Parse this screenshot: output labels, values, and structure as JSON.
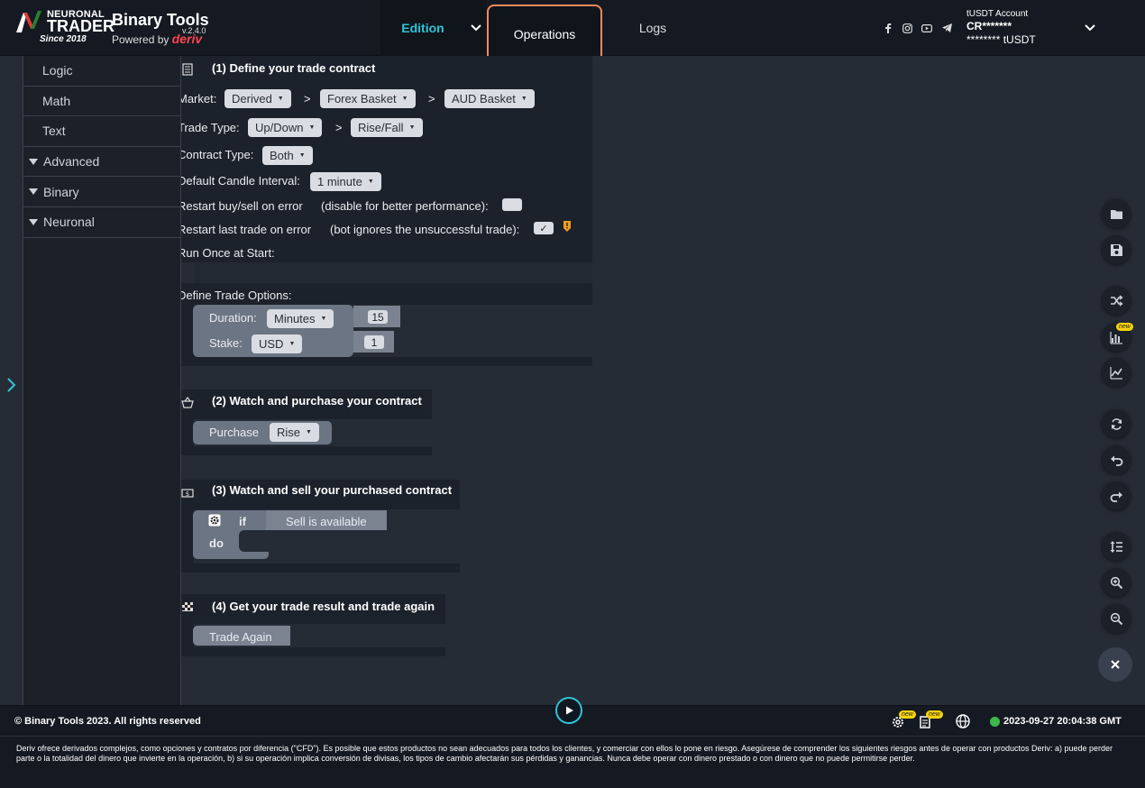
{
  "header": {
    "logo": {
      "neuronal": "NEURONAL",
      "trader": "TRADER",
      "since": "Since 2018",
      "brand": "Binary Tools",
      "version": "v.2.4.0",
      "powered_by": "Powered by",
      "deriv": "deriv"
    },
    "tabs": {
      "edition": "Edition",
      "operations": "Operations",
      "logs": "Logs"
    },
    "account": {
      "label": "tUSDT Account",
      "id": "CR*******",
      "balance": "******** tUSDT"
    }
  },
  "toolbox": {
    "items": [
      {
        "label": "Logic"
      },
      {
        "label": "Math"
      },
      {
        "label": "Text"
      },
      {
        "label": "Advanced"
      },
      {
        "label": "Binary"
      },
      {
        "label": "Neuronal"
      }
    ]
  },
  "blocks": {
    "trade_definition": {
      "title": "(1) Define your trade contract",
      "market_label": "Market:",
      "market": "Derived",
      "submarket": "Forex Basket",
      "symbol": "AUD Basket",
      "trade_type_label": "Trade Type:",
      "trade_type": "Up/Down",
      "trade_subtype": "Rise/Fall",
      "contract_type_label": "Contract Type:",
      "contract_type": "Both",
      "candle_label": "Default Candle Interval:",
      "candle_interval": "1 minute",
      "restart_buy_label": "Restart buy/sell on error",
      "restart_buy_hint": "(disable for better performance):",
      "restart_last_label": "Restart last trade on error",
      "restart_last_hint": "(bot ignores the unsuccessful trade):",
      "restart_last_checked": "✓",
      "run_once_label": "Run Once at Start:",
      "trade_options_label": "Define Trade Options:",
      "duration_label": "Duration:",
      "duration_unit": "Minutes",
      "duration_value": "15",
      "stake_label": "Stake:",
      "currency": "USD",
      "stake_value": "1",
      "gt": ">"
    },
    "purchase": {
      "title": "(2) Watch and purchase your contract",
      "purchase_label": "Purchase",
      "contract": "Rise"
    },
    "sell": {
      "title": "(3) Watch and sell your purchased contract",
      "if_label": "if",
      "condition": "Sell is available",
      "do_label": "do"
    },
    "result": {
      "title": "(4) Get your trade result and trade again",
      "trade_again": "Trade Again"
    }
  },
  "right_tools": {
    "new_badge": "new"
  },
  "footer": {
    "copyright": "© Binary Tools 2023. All rights reserved",
    "new_badge": "new",
    "datetime": "2023-09-27 20:04:38 GMT",
    "disclaimer": "Deriv ofrece derivados complejos, como opciones y contratos por diferencia (\"CFD\"). Es posible que estos productos no sean adecuados para todos los clientes, y comerciar con ellos lo pone en riesgo. Asegúrese de comprender los siguientes riesgos antes de operar con productos Deriv: a) puede perder parte o la totalidad del dinero que invierte en la operación, b) si su operación implica conversión de divisas, los tipos de cambio afectarán sus pérdidas y ganancias. Nunca debe operar con dinero prestado o con dinero que no puede permitirse perder."
  },
  "colors": {
    "accent": "#2ec4d6",
    "highlight": "#f08a5d",
    "status_online": "#3db84b",
    "deriv_red": "#ff444f"
  }
}
